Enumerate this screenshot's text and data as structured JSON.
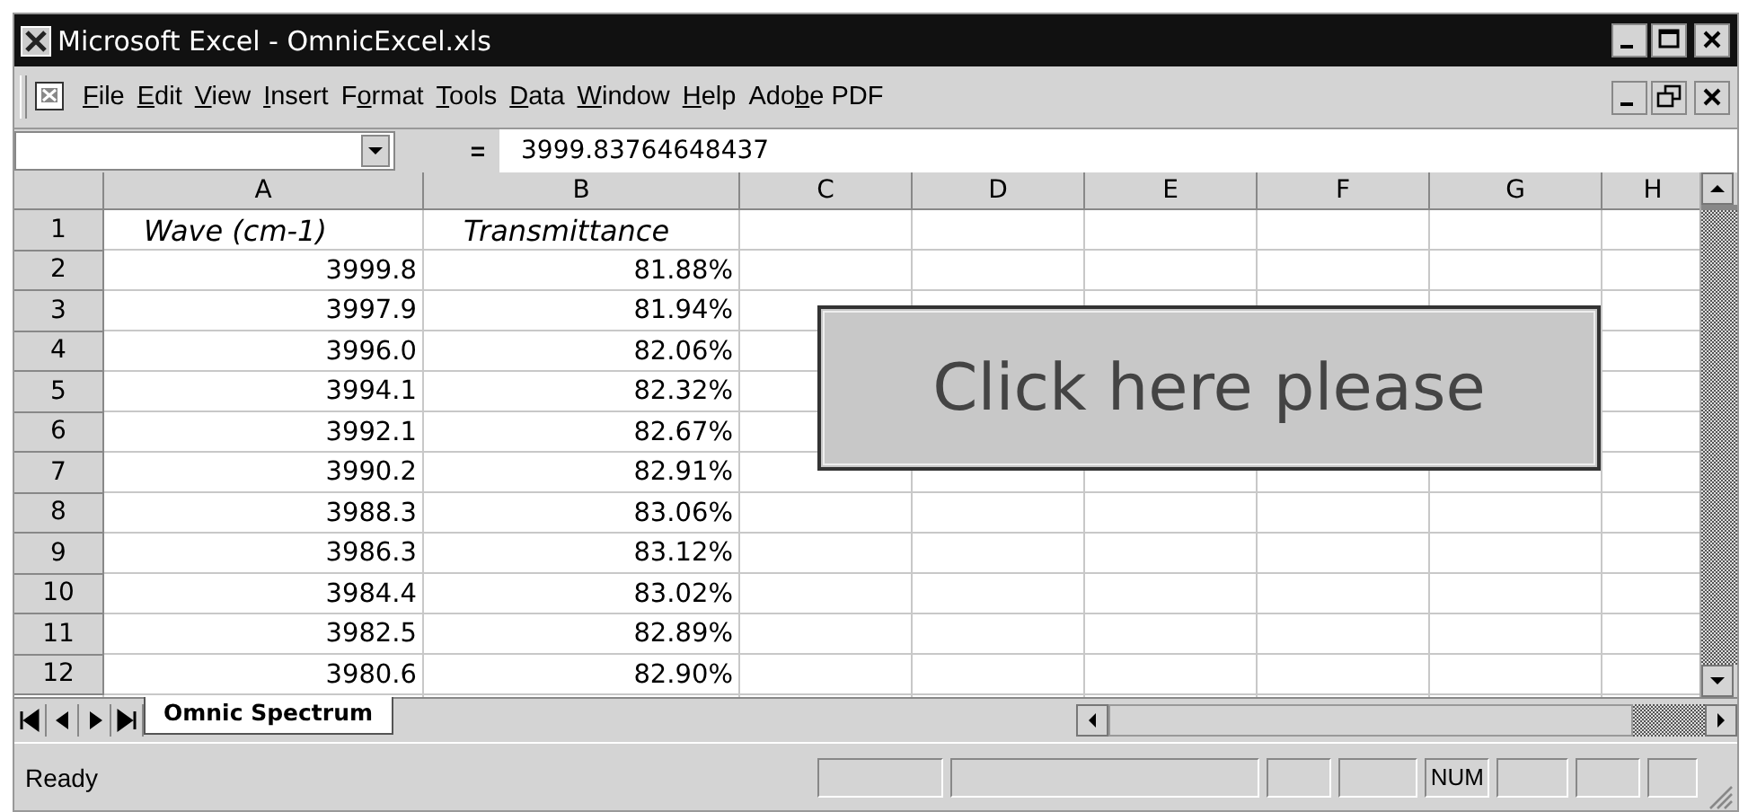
{
  "window": {
    "title": "Microsoft Excel - OmnicExcel.xls"
  },
  "menu": [
    {
      "key": "F",
      "post": "ile"
    },
    {
      "key": "E",
      "post": "dit"
    },
    {
      "key": "V",
      "post": "iew"
    },
    {
      "key": "I",
      "post": "nsert"
    },
    {
      "pre": "F",
      "key": "o",
      "post": "rmat"
    },
    {
      "key": "T",
      "post": "ools"
    },
    {
      "key": "D",
      "post": "ata"
    },
    {
      "key": "W",
      "post": "indow"
    },
    {
      "key": "H",
      "post": "elp"
    },
    {
      "pre": "Ado",
      "key": "b",
      "post": "e PDF"
    }
  ],
  "formula_bar": {
    "equals": "=",
    "value": "3999.83764648437"
  },
  "columns": [
    "A",
    "B",
    "C",
    "D",
    "E",
    "F",
    "G",
    "H"
  ],
  "rows": [
    {
      "label": "1",
      "cells": [
        "Wave (cm-1)",
        "Transmittance"
      ],
      "kind": "heading"
    },
    {
      "label": "2",
      "cells": [
        "3999.8",
        "81.88%"
      ],
      "kind": "number"
    },
    {
      "label": "3",
      "cells": [
        "3997.9",
        "81.94%"
      ],
      "kind": "number"
    },
    {
      "label": "4",
      "cells": [
        "3996.0",
        "82.06%"
      ],
      "kind": "number"
    },
    {
      "label": "5",
      "cells": [
        "3994.1",
        "82.32%"
      ],
      "kind": "number"
    },
    {
      "label": "6",
      "cells": [
        "3992.1",
        "82.67%"
      ],
      "kind": "number"
    },
    {
      "label": "7",
      "cells": [
        "3990.2",
        "82.91%"
      ],
      "kind": "number"
    },
    {
      "label": "8",
      "cells": [
        "3988.3",
        "83.06%"
      ],
      "kind": "number"
    },
    {
      "label": "9",
      "cells": [
        "3986.3",
        "83.12%"
      ],
      "kind": "number"
    },
    {
      "label": "10",
      "cells": [
        "3984.4",
        "83.02%"
      ],
      "kind": "number"
    },
    {
      "label": "11",
      "cells": [
        "3982.5",
        "82.89%"
      ],
      "kind": "number"
    },
    {
      "label": "12",
      "cells": [
        "3980.6",
        "82.90%"
      ],
      "kind": "number"
    }
  ],
  "sheet_button": {
    "label": "Click here please"
  },
  "sheet_tabs": [
    {
      "label": "Omnic Spectrum",
      "selected": true
    }
  ],
  "status_bar": {
    "text": "Ready",
    "indicators": [
      "NUM"
    ]
  }
}
